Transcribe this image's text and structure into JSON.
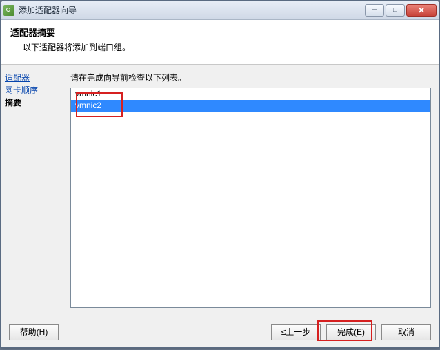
{
  "window": {
    "title": "添加适配器向导"
  },
  "header": {
    "title": "适配器摘要",
    "desc": "以下适配器将添加到端口组。"
  },
  "sidebar": {
    "items": [
      {
        "label": "适配器",
        "kind": "link"
      },
      {
        "label": "网卡顺序",
        "kind": "link"
      },
      {
        "label": "摘要",
        "kind": "current"
      }
    ]
  },
  "main": {
    "desc": "请在完成向导前检查以下列表。",
    "list": [
      {
        "label": "vmnic1",
        "selected": false
      },
      {
        "label": "vmnic2",
        "selected": true
      }
    ]
  },
  "footer": {
    "help": "帮助(H)",
    "back": "≤上一步",
    "finish": "完成(E)",
    "cancel": "取消"
  },
  "win_controls": {
    "min": "─",
    "max": "□",
    "close": "✕"
  }
}
